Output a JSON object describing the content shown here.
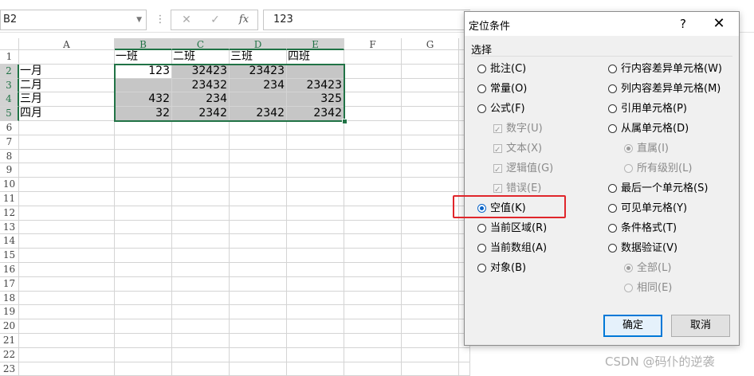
{
  "formula_bar": {
    "name_box": "B2",
    "formula": "123",
    "cancel_icon": "✕",
    "enter_icon": "✓",
    "fx_icon": "fx"
  },
  "sheet": {
    "columns": [
      "A",
      "B",
      "C",
      "D",
      "E",
      "F",
      "G"
    ],
    "rows": [
      "1",
      "2",
      "3",
      "4",
      "5",
      "6",
      "7",
      "8",
      "9",
      "10",
      "11",
      "12",
      "13",
      "14",
      "15",
      "16",
      "17",
      "18",
      "19",
      "20",
      "21",
      "22",
      "23"
    ],
    "cells": {
      "B1": "一班",
      "C1": "二班",
      "D1": "三班",
      "E1": "四班",
      "A2": "一月",
      "B2": "123",
      "C2": "32423",
      "D2": "23423",
      "A3": "二月",
      "C3": "23432",
      "D3": "234",
      "E3": "23423",
      "A4": "三月",
      "B4": "432",
      "C4": "234",
      "E4": "325",
      "A5": "四月",
      "B5": "32",
      "C5": "2342",
      "D5": "2342",
      "E5": "2342"
    }
  },
  "dialog": {
    "title": "定位条件",
    "help": "?",
    "close": "✕",
    "group_label": "选择",
    "options_left": [
      {
        "label": "批注(C)",
        "type": "radio",
        "checked": false,
        "disabled": false
      },
      {
        "label": "常量(O)",
        "type": "radio",
        "checked": false,
        "disabled": false
      },
      {
        "label": "公式(F)",
        "type": "radio",
        "checked": false,
        "disabled": false
      },
      {
        "label": "数字(U)",
        "type": "check",
        "checked": true,
        "disabled": true
      },
      {
        "label": "文本(X)",
        "type": "check",
        "checked": true,
        "disabled": true
      },
      {
        "label": "逻辑值(G)",
        "type": "check",
        "checked": true,
        "disabled": true
      },
      {
        "label": "错误(E)",
        "type": "check",
        "checked": true,
        "disabled": true
      },
      {
        "label": "空值(K)",
        "type": "radio",
        "checked": true,
        "disabled": false
      },
      {
        "label": "当前区域(R)",
        "type": "radio",
        "checked": false,
        "disabled": false
      },
      {
        "label": "当前数组(A)",
        "type": "radio",
        "checked": false,
        "disabled": false
      },
      {
        "label": "对象(B)",
        "type": "radio",
        "checked": false,
        "disabled": false
      }
    ],
    "options_right": [
      {
        "label": "行内容差异单元格(W)",
        "type": "radio",
        "checked": false,
        "disabled": false
      },
      {
        "label": "列内容差异单元格(M)",
        "type": "radio",
        "checked": false,
        "disabled": false
      },
      {
        "label": "引用单元格(P)",
        "type": "radio",
        "checked": false,
        "disabled": false
      },
      {
        "label": "从属单元格(D)",
        "type": "radio",
        "checked": false,
        "disabled": false
      },
      {
        "label": "直属(I)",
        "type": "radio",
        "checked": true,
        "disabled": true
      },
      {
        "label": "所有级别(L)",
        "type": "radio",
        "checked": false,
        "disabled": true
      },
      {
        "label": "最后一个单元格(S)",
        "type": "radio",
        "checked": false,
        "disabled": false
      },
      {
        "label": "可见单元格(Y)",
        "type": "radio",
        "checked": false,
        "disabled": false
      },
      {
        "label": "条件格式(T)",
        "type": "radio",
        "checked": false,
        "disabled": false
      },
      {
        "label": "数据验证(V)",
        "type": "radio",
        "checked": false,
        "disabled": false
      },
      {
        "label": "全部(L)",
        "type": "radio",
        "checked": true,
        "disabled": true
      },
      {
        "label": "相同(E)",
        "type": "radio",
        "checked": false,
        "disabled": true
      }
    ],
    "ok_label": "确定",
    "cancel_label": "取消"
  },
  "watermark": "CSDN @码仆的逆袭"
}
